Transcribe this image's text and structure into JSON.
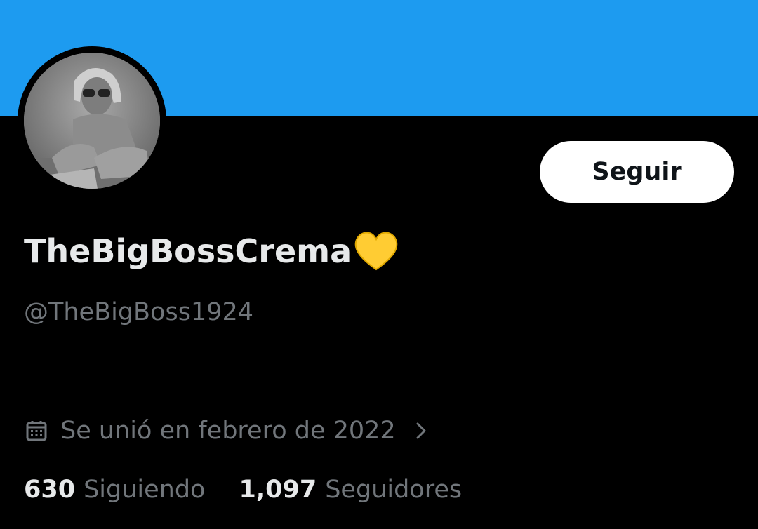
{
  "profile": {
    "display_name": "TheBigBossCrema",
    "name_emoji": "yellow-heart",
    "handle": "@TheBigBoss1924",
    "joined": "Se unió en febrero de 2022"
  },
  "actions": {
    "follow_label": "Seguir"
  },
  "stats": {
    "following_count": "630",
    "following_label": "Siguiendo",
    "followers_count": "1,097",
    "followers_label": "Seguidores"
  },
  "icons": {
    "calendar": "calendar-icon",
    "chevron": "chevron-right-icon",
    "heart": "yellow-heart-icon"
  },
  "colors": {
    "banner": "#1d9bf0",
    "background": "#000000",
    "primary_text": "#e7e9ea",
    "secondary_text": "#71767b",
    "button_bg": "#ffffff",
    "button_text": "#0f1419",
    "heart": "#ffcc33"
  }
}
